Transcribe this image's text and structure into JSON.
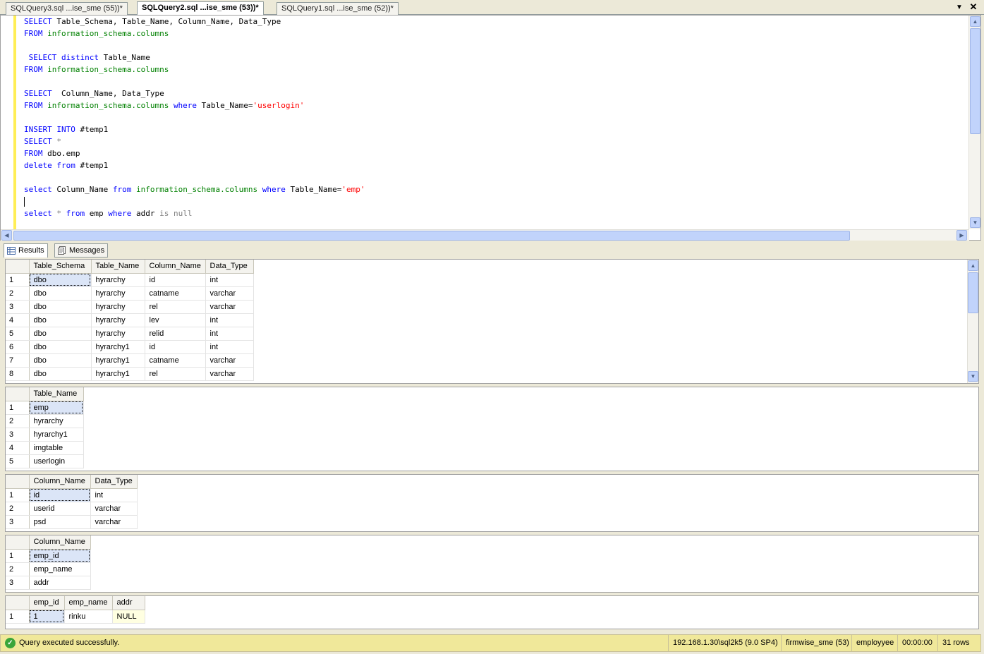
{
  "doc_tabs": [
    {
      "label": "SQLQuery3.sql ...ise_sme (55))*",
      "active": false
    },
    {
      "label": "SQLQuery2.sql ...ise_sme (53))*",
      "active": true
    },
    {
      "label": "SQLQuery1.sql ...ise_sme (52))*",
      "active": false
    }
  ],
  "editor": {
    "lines": [
      [
        {
          "t": "SELECT",
          "c": "kw"
        },
        {
          "t": " Table_Schema, Table_Name, Column_Name, Data_Type",
          "c": ""
        }
      ],
      [
        {
          "t": "FROM",
          "c": "kw"
        },
        {
          "t": " ",
          "c": ""
        },
        {
          "t": "information_schema.columns",
          "c": "gr"
        }
      ],
      [],
      [
        {
          "t": " ",
          "c": ""
        },
        {
          "t": "SELECT distinct",
          "c": "kw"
        },
        {
          "t": " Table_Name",
          "c": ""
        }
      ],
      [
        {
          "t": "FROM",
          "c": "kw"
        },
        {
          "t": " ",
          "c": ""
        },
        {
          "t": "information_schema.columns",
          "c": "gr"
        }
      ],
      [],
      [
        {
          "t": "SELECT",
          "c": "kw"
        },
        {
          "t": "  Column_Name, Data_Type",
          "c": ""
        }
      ],
      [
        {
          "t": "FROM",
          "c": "kw"
        },
        {
          "t": " ",
          "c": ""
        },
        {
          "t": "information_schema.columns",
          "c": "gr"
        },
        {
          "t": " ",
          "c": ""
        },
        {
          "t": "where",
          "c": "kw"
        },
        {
          "t": " Table_Name=",
          "c": ""
        },
        {
          "t": "'userlogin'",
          "c": "rd"
        }
      ],
      [],
      [
        {
          "t": "INSERT INTO",
          "c": "kw"
        },
        {
          "t": " #temp1",
          "c": ""
        }
      ],
      [
        {
          "t": "SELECT",
          "c": "kw"
        },
        {
          "t": " *",
          "c": "gy"
        }
      ],
      [
        {
          "t": "FROM",
          "c": "kw"
        },
        {
          "t": " dbo.emp",
          "c": ""
        }
      ],
      [
        {
          "t": "delete from",
          "c": "kw"
        },
        {
          "t": " #temp1",
          "c": ""
        }
      ],
      [],
      [
        {
          "t": "select",
          "c": "kw"
        },
        {
          "t": " Column_Name ",
          "c": ""
        },
        {
          "t": "from",
          "c": "kw"
        },
        {
          "t": " ",
          "c": ""
        },
        {
          "t": "information_schema.columns",
          "c": "gr"
        },
        {
          "t": " ",
          "c": ""
        },
        {
          "t": "where",
          "c": "kw"
        },
        {
          "t": " Table_Name=",
          "c": ""
        },
        {
          "t": "'emp'",
          "c": "rd"
        }
      ],
      [
        {
          "caret": true
        }
      ],
      [
        {
          "t": "select",
          "c": "kw"
        },
        {
          "t": " * ",
          "c": "gy"
        },
        {
          "t": "from",
          "c": "kw"
        },
        {
          "t": " emp ",
          "c": ""
        },
        {
          "t": "where",
          "c": "kw"
        },
        {
          "t": " addr ",
          "c": ""
        },
        {
          "t": "is null",
          "c": "gy"
        }
      ]
    ]
  },
  "result_tabs": [
    {
      "label": "Results",
      "icon": "grid-icon",
      "active": true
    },
    {
      "label": "Messages",
      "icon": "messages-icon",
      "active": false
    }
  ],
  "grids": [
    {
      "columns": [
        "Table_Schema",
        "Table_Name",
        "Column_Name",
        "Data_Type"
      ],
      "rows": [
        [
          "1",
          "dbo",
          "hyrarchy",
          "id",
          "int"
        ],
        [
          "2",
          "dbo",
          "hyrarchy",
          "catname",
          "varchar"
        ],
        [
          "3",
          "dbo",
          "hyrarchy",
          "rel",
          "varchar"
        ],
        [
          "4",
          "dbo",
          "hyrarchy",
          "lev",
          "int"
        ],
        [
          "5",
          "dbo",
          "hyrarchy",
          "relid",
          "int"
        ],
        [
          "6",
          "dbo",
          "hyrarchy1",
          "id",
          "int"
        ],
        [
          "7",
          "dbo",
          "hyrarchy1",
          "catname",
          "varchar"
        ],
        [
          "8",
          "dbo",
          "hyrarchy1",
          "rel",
          "varchar"
        ]
      ]
    },
    {
      "columns": [
        "Table_Name"
      ],
      "rows": [
        [
          "1",
          "emp"
        ],
        [
          "2",
          "hyrarchy"
        ],
        [
          "3",
          "hyrarchy1"
        ],
        [
          "4",
          "imgtable"
        ],
        [
          "5",
          "userlogin"
        ]
      ]
    },
    {
      "columns": [
        "Column_Name",
        "Data_Type"
      ],
      "rows": [
        [
          "1",
          "id",
          "int"
        ],
        [
          "2",
          "userid",
          "varchar"
        ],
        [
          "3",
          "psd",
          "varchar"
        ]
      ]
    },
    {
      "columns": [
        "Column_Name"
      ],
      "rows": [
        [
          "1",
          "emp_id"
        ],
        [
          "2",
          "emp_name"
        ],
        [
          "3",
          "addr"
        ]
      ]
    },
    {
      "columns": [
        "emp_id",
        "emp_name",
        "addr"
      ],
      "rows": [
        [
          "1",
          "1",
          "rinku",
          "NULL"
        ]
      ]
    }
  ],
  "status": {
    "message": "Query executed successfully.",
    "server": "192.168.1.30\\sql2k5 (9.0 SP4)",
    "database_session": "firmwise_sme (53)",
    "user": "employyee",
    "elapsed": "00:00:00",
    "rows": "31 rows",
    "ok_color": "#3aa53a"
  }
}
